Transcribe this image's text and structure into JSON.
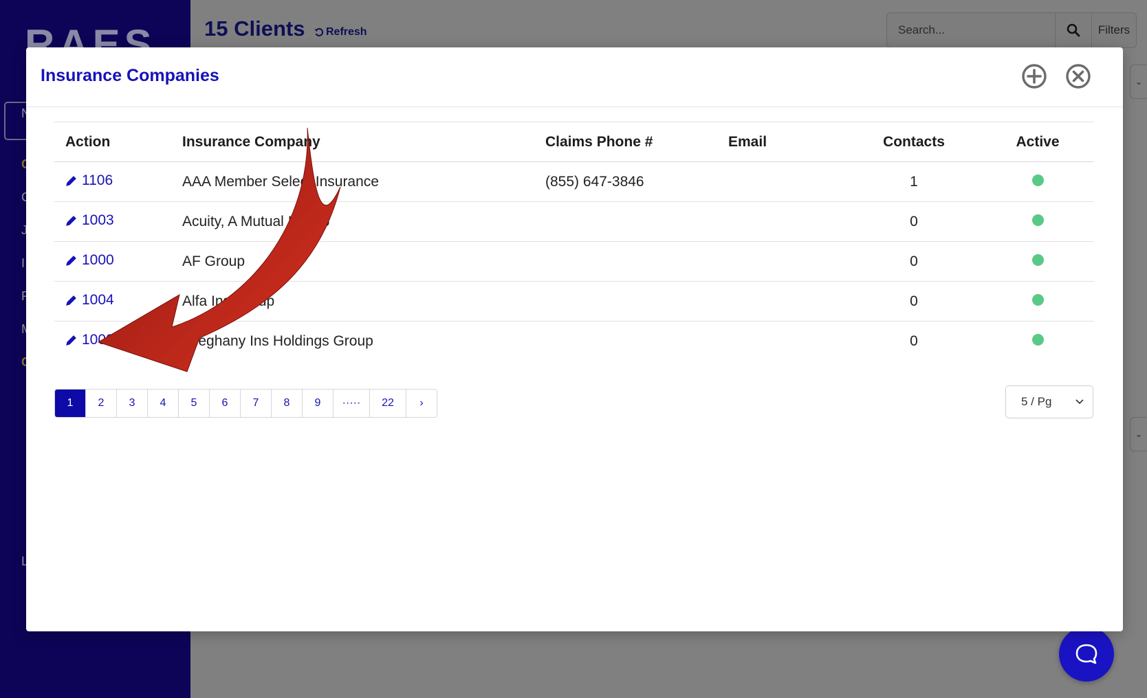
{
  "background": {
    "logo": "RAES",
    "sidebar_letters": [
      "N",
      "C",
      "C",
      "J",
      "I",
      "R",
      "M",
      "C",
      "L"
    ],
    "page_title": "15 Clients",
    "refresh_label": "Refresh",
    "search_placeholder": "Search...",
    "filters_label": "Filters"
  },
  "modal": {
    "title": "Insurance Companies",
    "columns": [
      "Action",
      "Insurance Company",
      "Claims Phone #",
      "Email",
      "Contacts",
      "Active"
    ],
    "rows": [
      {
        "id": "1106",
        "company": "AAA Member Select Insurance",
        "phone": "(855) 647-3846",
        "email": "",
        "contacts": "1",
        "active": true
      },
      {
        "id": "1003",
        "company": "Acuity, A Mutual Ins Co",
        "phone": "",
        "email": "",
        "contacts": "0",
        "active": true
      },
      {
        "id": "1000",
        "company": "AF Group",
        "phone": "",
        "email": "",
        "contacts": "0",
        "active": true
      },
      {
        "id": "1004",
        "company": "Alfa Ins Group",
        "phone": "",
        "email": "",
        "contacts": "0",
        "active": true
      },
      {
        "id": "1002",
        "company": "Alleghany Ins Holdings Group",
        "phone": "",
        "email": "",
        "contacts": "0",
        "active": true
      }
    ],
    "pagination": {
      "pages": [
        "1",
        "2",
        "3",
        "4",
        "5",
        "6",
        "7",
        "8",
        "9",
        "·····",
        "22",
        "›"
      ],
      "current": "1"
    },
    "per_page": "5 / Pg"
  },
  "colors": {
    "brand_blue": "#1712b8",
    "sidebar_navy": "#0d0457",
    "active_green": "#5ac988",
    "arrow_red": "#c8281e"
  },
  "icons": [
    "plus-circle-icon",
    "close-circle-icon",
    "pencil-icon",
    "search-icon",
    "refresh-icon",
    "chat-icon",
    "chevron-down-icon"
  ]
}
